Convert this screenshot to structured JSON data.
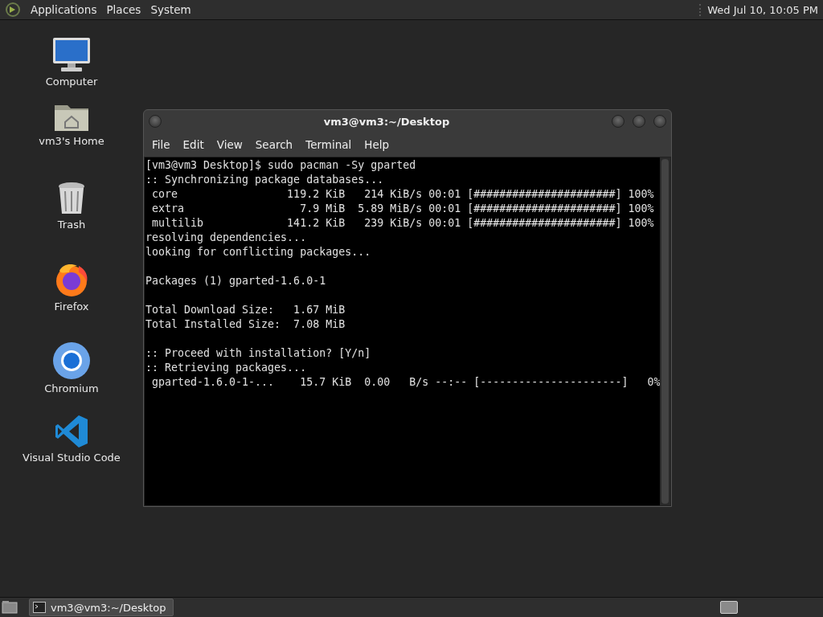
{
  "top_panel": {
    "menus": [
      "Applications",
      "Places",
      "System"
    ],
    "clock": "Wed Jul 10, 10:05 PM"
  },
  "desktop_icons": [
    {
      "label": "Computer",
      "kind": "computer"
    },
    {
      "label": "vm3's Home",
      "kind": "folder"
    },
    {
      "label": "Trash",
      "kind": "trash"
    },
    {
      "label": "Firefox",
      "kind": "firefox"
    },
    {
      "label": "Chromium",
      "kind": "chromium"
    },
    {
      "label": "Visual Studio Code",
      "kind": "vscode"
    }
  ],
  "window": {
    "title": "vm3@vm3:~/Desktop",
    "menu": [
      "File",
      "Edit",
      "View",
      "Search",
      "Terminal",
      "Help"
    ],
    "terminal_blocks": [
      [
        "[vm3@vm3 Desktop]$ sudo pacman -Sy gparted",
        ":: Synchronizing package databases...",
        " core                 119.2 KiB   214 KiB/s 00:01 [######################] 100%",
        " extra                  7.9 MiB  5.89 MiB/s 00:01 [######################] 100%",
        " multilib             141.2 KiB   239 KiB/s 00:01 [######################] 100%",
        "resolving dependencies...",
        "looking for conflicting packages..."
      ],
      [
        "Packages (1) gparted-1.6.0-1"
      ],
      [
        "Total Download Size:   1.67 MiB",
        "Total Installed Size:  7.08 MiB"
      ],
      [
        ":: Proceed with installation? [Y/n]",
        ":: Retrieving packages...",
        " gparted-1.6.0-1-...    15.7 KiB  0.00   B/s --:-- [----------------------]   0%"
      ]
    ]
  },
  "taskbar": {
    "tasks": [
      {
        "label": "vm3@vm3:~/Desktop",
        "selected": true
      }
    ]
  }
}
